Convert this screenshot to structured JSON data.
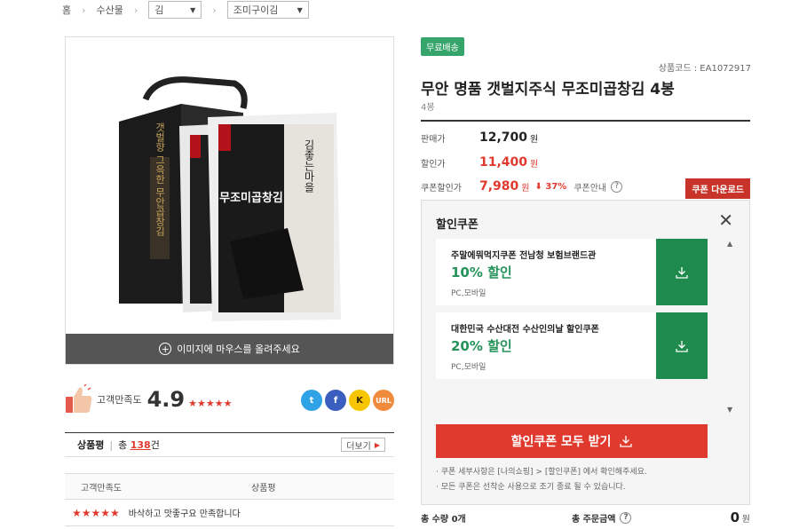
{
  "breadcrumb": {
    "home": "홈",
    "cat1": "수산물",
    "cat2": "김",
    "cat3": "조미구이김"
  },
  "gallery": {
    "hover_hint": "이미지에 마우스를 올려주세요",
    "pack_text": "김좋는마을",
    "box_text": "갯벌향 그윽한 무안곱창김",
    "bag_text": "무조미곱창김"
  },
  "rating": {
    "label": "고객만족도",
    "score": "4.9",
    "stars": "★★★★★"
  },
  "share": {
    "twitter": "t",
    "facebook": "f",
    "kakao": "K",
    "url": "URL"
  },
  "reviews": {
    "title": "상품평",
    "total_prefix": "총",
    "count": "138",
    "total_suffix": "건",
    "more": "더보기",
    "col_rating": "고객만족도",
    "col_review": "상품평",
    "first_stars": "★★★★★",
    "first_text": "바삭하고 맛좋구요 만족합니다"
  },
  "product": {
    "badge": "무료배송",
    "code": "상품코드 : EA1072917",
    "title": "무안 명품 갯벌지주식 무조미곱창김 4봉",
    "subtitle": "4봉",
    "sale_label": "판매가",
    "sale_price": "12,700",
    "discount_label": "할인가",
    "discount_price": "11,400",
    "coupon_label": "쿠폰할인가",
    "coupon_price": "7,980",
    "coupon_rate": "37%",
    "coupon_info": "쿠폰안내",
    "won": "원",
    "coupon_download": "쿠폰 다운로드"
  },
  "coupon_panel": {
    "title": "할인쿠폰",
    "coupons": [
      {
        "name": "주말에뭐먹지쿠폰 전남청 보험브랜드관",
        "percent": "10% 할인",
        "device": "PC,모바일"
      },
      {
        "name": "대한민국 수산대전 수산인의날 할인쿠폰",
        "percent": "20% 할인",
        "device": "PC,모바일"
      }
    ],
    "download_all": "할인쿠폰 모두 받기",
    "note1": "쿠폰 세부사항은 [나의쇼핑] > [할인쿠폰] 에서 확인해주세요.",
    "note2": "모든 쿠폰은 선착순 사용으로 조기 종료 될 수 있습니다."
  },
  "order": {
    "qty_label": "총 수량 0개",
    "sum_label": "총 주문금액",
    "amount": "0",
    "won": "원"
  },
  "colors": {
    "accent_red": "#e03a2f",
    "coupon_green": "#1f8a4d",
    "free_shipping": "#35a56b"
  }
}
